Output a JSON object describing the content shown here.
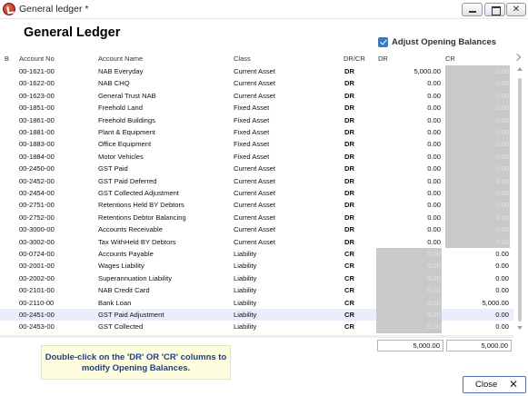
{
  "window": {
    "title": "General ledger *",
    "controls": {
      "minimize": "minimize-icon",
      "maximize": "maximize-icon",
      "close": "close-icon"
    }
  },
  "page": {
    "heading": "General Ledger",
    "opening_balances_label": "Adjust Opening Balances",
    "opening_balances_checked": true
  },
  "columns": [
    "B",
    "Account No",
    "Account Name",
    "Class",
    "DR/CR",
    "DR",
    "CR"
  ],
  "rows": [
    {
      "account_no": "00-1621-00",
      "account_name": "NAB Everyday",
      "class": "Current Asset",
      "drcr": "DR",
      "dr": "5,000.00",
      "cr": "0.00"
    },
    {
      "account_no": "00-1622-00",
      "account_name": "NAB CHQ",
      "class": "Current Asset",
      "drcr": "DR",
      "dr": "0.00",
      "cr": "0.00"
    },
    {
      "account_no": "00-1623-00",
      "account_name": "General Trust NAB",
      "class": "Current Asset",
      "drcr": "DR",
      "dr": "0.00",
      "cr": "0.00"
    },
    {
      "account_no": "00-1851-00",
      "account_name": "Freehold Land",
      "class": "Fixed Asset",
      "drcr": "DR",
      "dr": "0.00",
      "cr": "0.00"
    },
    {
      "account_no": "00-1861-00",
      "account_name": "Freehold Buildings",
      "class": "Fixed Asset",
      "drcr": "DR",
      "dr": "0.00",
      "cr": "0.00"
    },
    {
      "account_no": "00-1881-00",
      "account_name": "Plant & Equipment",
      "class": "Fixed Asset",
      "drcr": "DR",
      "dr": "0.00",
      "cr": "0.00"
    },
    {
      "account_no": "00-1883-00",
      "account_name": "Office Equipment",
      "class": "Fixed Asset",
      "drcr": "DR",
      "dr": "0.00",
      "cr": "0.00"
    },
    {
      "account_no": "00-1884-00",
      "account_name": "Motor Vehicles",
      "class": "Fixed Asset",
      "drcr": "DR",
      "dr": "0.00",
      "cr": "0.00"
    },
    {
      "account_no": "00-2450-00",
      "account_name": "GST Paid",
      "class": "Current Asset",
      "drcr": "DR",
      "dr": "0.00",
      "cr": "0.00"
    },
    {
      "account_no": "00-2452-00",
      "account_name": "GST Paid Deferred",
      "class": "Current Asset",
      "drcr": "DR",
      "dr": "0.00",
      "cr": "0.00"
    },
    {
      "account_no": "00-2454-00",
      "account_name": "GST Collected Adjustment",
      "class": "Current Asset",
      "drcr": "DR",
      "dr": "0.00",
      "cr": "0.00"
    },
    {
      "account_no": "00-2751-00",
      "account_name": "Retentions Held BY Debtors",
      "class": "Current Asset",
      "drcr": "DR",
      "dr": "0.00",
      "cr": "0.00"
    },
    {
      "account_no": "00-2752-00",
      "account_name": "Retentions Debtor Balancing",
      "class": "Current Asset",
      "drcr": "DR",
      "dr": "0.00",
      "cr": "0.00"
    },
    {
      "account_no": "00-3000-00",
      "account_name": "Accounts Receivable",
      "class": "Current Asset",
      "drcr": "DR",
      "dr": "0.00",
      "cr": "0.00"
    },
    {
      "account_no": "00-3002-00",
      "account_name": "Tax WithHeld BY Debtors",
      "class": "Current Asset",
      "drcr": "DR",
      "dr": "0.00",
      "cr": "0.00"
    },
    {
      "account_no": "00-0724-00",
      "account_name": "Accounts Payable",
      "class": "Liability",
      "drcr": "CR",
      "dr": "0.00",
      "cr": "0.00"
    },
    {
      "account_no": "00-2001-00",
      "account_name": "Wages Liability",
      "class": "Liability",
      "drcr": "CR",
      "dr": "0.00",
      "cr": "0.00"
    },
    {
      "account_no": "00-2002-00",
      "account_name": "Superannuation Liability",
      "class": "Liability",
      "drcr": "CR",
      "dr": "0.00",
      "cr": "0.00"
    },
    {
      "account_no": "00-2101-00",
      "account_name": "NAB Credit Card",
      "class": "Liability",
      "drcr": "CR",
      "dr": "0.00",
      "cr": "0.00"
    },
    {
      "account_no": "00-2110-00",
      "account_name": "Bank Loan",
      "class": "Liability",
      "drcr": "CR",
      "dr": "0.00",
      "cr": "5,000.00"
    },
    {
      "account_no": "00-2451-00",
      "account_name": "GST Paid Adjustment",
      "class": "Liability",
      "drcr": "CR",
      "dr": "0.00",
      "cr": "0.00",
      "selected": true
    },
    {
      "account_no": "00-2453-00",
      "account_name": "GST Collected",
      "class": "Liability",
      "drcr": "CR",
      "dr": "0.00",
      "cr": "0.00"
    }
  ],
  "totals": {
    "dr": "5,000.00",
    "cr": "5,000.00"
  },
  "hint": {
    "line1": "Double-click on the 'DR' OR 'CR' columns to",
    "line2": "modify Opening Balances."
  },
  "buttons": {
    "close_label": "Close",
    "close_icon": "close-x-icon"
  },
  "colors": {
    "disabled_cell": "#c9c9c9",
    "selected_row": "#e8eefb",
    "hint_bg": "#fefde0",
    "hint_text": "#1b3f8c",
    "checkbox": "#3b77c8"
  }
}
